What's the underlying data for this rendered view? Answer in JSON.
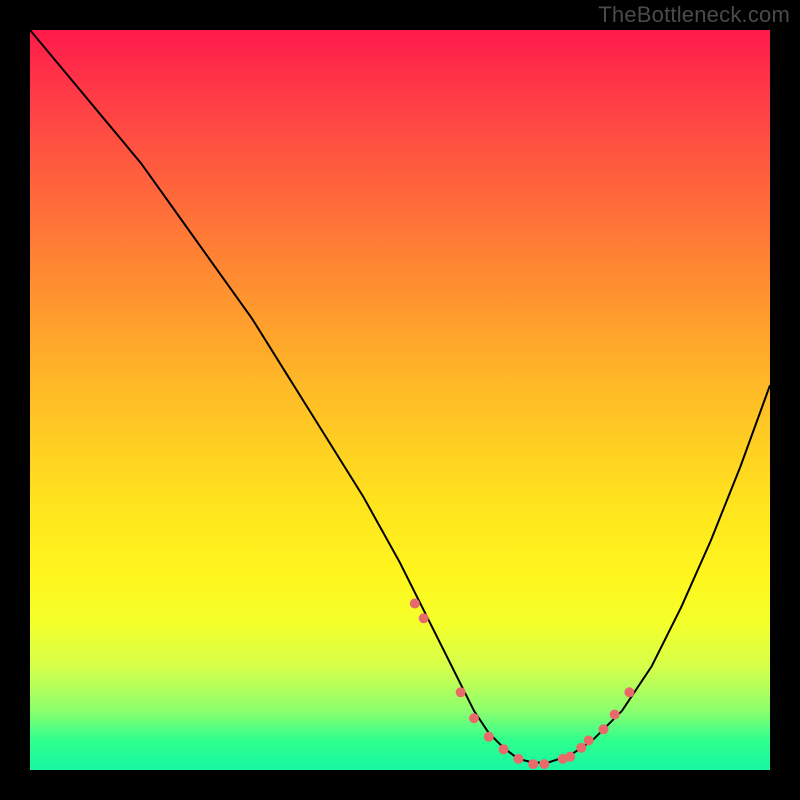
{
  "watermark": "TheBottleneck.com",
  "colors": {
    "background": "#000000",
    "gradient_top": "#ff1a4b",
    "gradient_bottom": "#17f7a3",
    "curve": "#000000",
    "dots": "#e96a6a"
  },
  "chart_data": {
    "type": "line",
    "title": "",
    "xlabel": "",
    "ylabel": "",
    "xlim": [
      0,
      100
    ],
    "ylim": [
      0,
      100
    ],
    "grid": false,
    "series": [
      {
        "name": "bottleneck-curve",
        "x": [
          0,
          5,
          10,
          15,
          20,
          25,
          30,
          35,
          40,
          45,
          50,
          53,
          56,
          58,
          60,
          62,
          64,
          66,
          68,
          70,
          73,
          76,
          80,
          84,
          88,
          92,
          96,
          100
        ],
        "values": [
          100,
          94,
          88,
          82,
          75,
          68,
          61,
          53,
          45,
          37,
          28,
          22,
          16,
          12,
          8,
          5,
          3,
          1.5,
          1,
          1,
          2,
          4,
          8,
          14,
          22,
          31,
          41,
          52
        ]
      }
    ],
    "dots": {
      "name": "highlight-dots",
      "x": [
        52.0,
        53.2,
        58.2,
        60.0,
        62.0,
        64.0,
        66.0,
        68.0,
        69.5,
        72.0,
        73.0,
        74.5,
        75.5,
        77.5,
        79.0,
        81.0
      ],
      "values": [
        22.5,
        20.5,
        10.5,
        7.0,
        4.5,
        2.8,
        1.5,
        0.8,
        0.8,
        1.5,
        1.8,
        3.0,
        4.0,
        5.5,
        7.5,
        10.5
      ]
    },
    "dot_radius_px": 5
  }
}
